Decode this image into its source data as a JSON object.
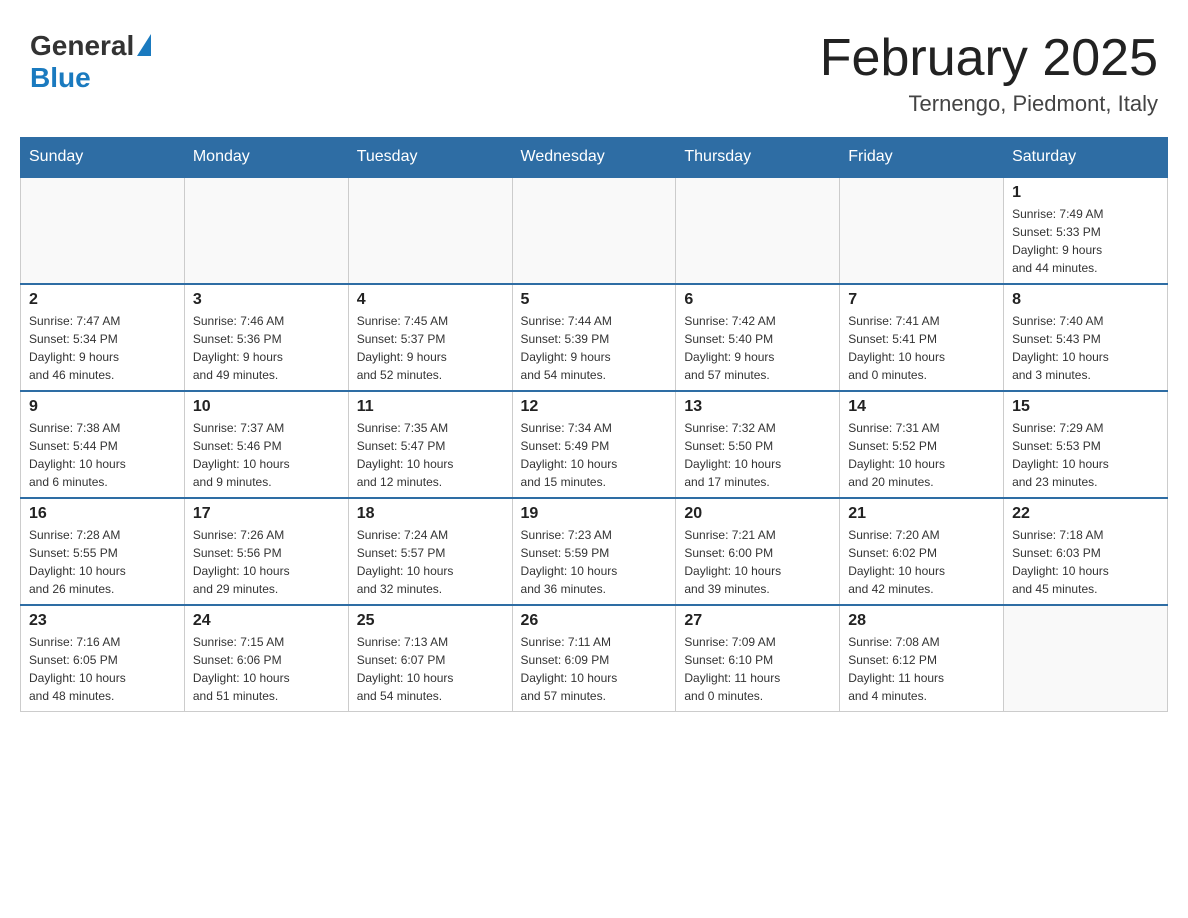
{
  "header": {
    "logo_general": "General",
    "logo_blue": "Blue",
    "month_title": "February 2025",
    "location": "Ternengo, Piedmont, Italy"
  },
  "weekdays": [
    "Sunday",
    "Monday",
    "Tuesday",
    "Wednesday",
    "Thursday",
    "Friday",
    "Saturday"
  ],
  "weeks": [
    [
      {
        "day": "",
        "info": ""
      },
      {
        "day": "",
        "info": ""
      },
      {
        "day": "",
        "info": ""
      },
      {
        "day": "",
        "info": ""
      },
      {
        "day": "",
        "info": ""
      },
      {
        "day": "",
        "info": ""
      },
      {
        "day": "1",
        "info": "Sunrise: 7:49 AM\nSunset: 5:33 PM\nDaylight: 9 hours\nand 44 minutes."
      }
    ],
    [
      {
        "day": "2",
        "info": "Sunrise: 7:47 AM\nSunset: 5:34 PM\nDaylight: 9 hours\nand 46 minutes."
      },
      {
        "day": "3",
        "info": "Sunrise: 7:46 AM\nSunset: 5:36 PM\nDaylight: 9 hours\nand 49 minutes."
      },
      {
        "day": "4",
        "info": "Sunrise: 7:45 AM\nSunset: 5:37 PM\nDaylight: 9 hours\nand 52 minutes."
      },
      {
        "day": "5",
        "info": "Sunrise: 7:44 AM\nSunset: 5:39 PM\nDaylight: 9 hours\nand 54 minutes."
      },
      {
        "day": "6",
        "info": "Sunrise: 7:42 AM\nSunset: 5:40 PM\nDaylight: 9 hours\nand 57 minutes."
      },
      {
        "day": "7",
        "info": "Sunrise: 7:41 AM\nSunset: 5:41 PM\nDaylight: 10 hours\nand 0 minutes."
      },
      {
        "day": "8",
        "info": "Sunrise: 7:40 AM\nSunset: 5:43 PM\nDaylight: 10 hours\nand 3 minutes."
      }
    ],
    [
      {
        "day": "9",
        "info": "Sunrise: 7:38 AM\nSunset: 5:44 PM\nDaylight: 10 hours\nand 6 minutes."
      },
      {
        "day": "10",
        "info": "Sunrise: 7:37 AM\nSunset: 5:46 PM\nDaylight: 10 hours\nand 9 minutes."
      },
      {
        "day": "11",
        "info": "Sunrise: 7:35 AM\nSunset: 5:47 PM\nDaylight: 10 hours\nand 12 minutes."
      },
      {
        "day": "12",
        "info": "Sunrise: 7:34 AM\nSunset: 5:49 PM\nDaylight: 10 hours\nand 15 minutes."
      },
      {
        "day": "13",
        "info": "Sunrise: 7:32 AM\nSunset: 5:50 PM\nDaylight: 10 hours\nand 17 minutes."
      },
      {
        "day": "14",
        "info": "Sunrise: 7:31 AM\nSunset: 5:52 PM\nDaylight: 10 hours\nand 20 minutes."
      },
      {
        "day": "15",
        "info": "Sunrise: 7:29 AM\nSunset: 5:53 PM\nDaylight: 10 hours\nand 23 minutes."
      }
    ],
    [
      {
        "day": "16",
        "info": "Sunrise: 7:28 AM\nSunset: 5:55 PM\nDaylight: 10 hours\nand 26 minutes."
      },
      {
        "day": "17",
        "info": "Sunrise: 7:26 AM\nSunset: 5:56 PM\nDaylight: 10 hours\nand 29 minutes."
      },
      {
        "day": "18",
        "info": "Sunrise: 7:24 AM\nSunset: 5:57 PM\nDaylight: 10 hours\nand 32 minutes."
      },
      {
        "day": "19",
        "info": "Sunrise: 7:23 AM\nSunset: 5:59 PM\nDaylight: 10 hours\nand 36 minutes."
      },
      {
        "day": "20",
        "info": "Sunrise: 7:21 AM\nSunset: 6:00 PM\nDaylight: 10 hours\nand 39 minutes."
      },
      {
        "day": "21",
        "info": "Sunrise: 7:20 AM\nSunset: 6:02 PM\nDaylight: 10 hours\nand 42 minutes."
      },
      {
        "day": "22",
        "info": "Sunrise: 7:18 AM\nSunset: 6:03 PM\nDaylight: 10 hours\nand 45 minutes."
      }
    ],
    [
      {
        "day": "23",
        "info": "Sunrise: 7:16 AM\nSunset: 6:05 PM\nDaylight: 10 hours\nand 48 minutes."
      },
      {
        "day": "24",
        "info": "Sunrise: 7:15 AM\nSunset: 6:06 PM\nDaylight: 10 hours\nand 51 minutes."
      },
      {
        "day": "25",
        "info": "Sunrise: 7:13 AM\nSunset: 6:07 PM\nDaylight: 10 hours\nand 54 minutes."
      },
      {
        "day": "26",
        "info": "Sunrise: 7:11 AM\nSunset: 6:09 PM\nDaylight: 10 hours\nand 57 minutes."
      },
      {
        "day": "27",
        "info": "Sunrise: 7:09 AM\nSunset: 6:10 PM\nDaylight: 11 hours\nand 0 minutes."
      },
      {
        "day": "28",
        "info": "Sunrise: 7:08 AM\nSunset: 6:12 PM\nDaylight: 11 hours\nand 4 minutes."
      },
      {
        "day": "",
        "info": ""
      }
    ]
  ]
}
